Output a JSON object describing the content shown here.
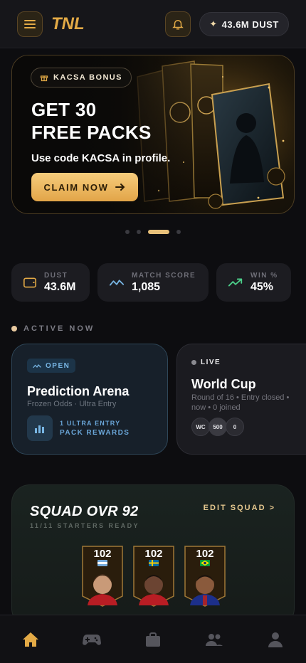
{
  "header": {
    "logo": "TNL",
    "dust_balance": "43.6M DUST"
  },
  "hero": {
    "badge": "KACSA BONUS",
    "title_line1": "GET 30",
    "title_line2": "FREE PACKS",
    "subtitle": "Use code KACSA in profile.",
    "cta": "CLAIM NOW",
    "slides_total": 4,
    "slide_active": 3
  },
  "stats": [
    {
      "label": "DUST",
      "value": "43.6M",
      "icon": "wallet-icon"
    },
    {
      "label": "MATCH SCORE",
      "value": "1,085",
      "icon": "activity-icon"
    },
    {
      "label": "WIN %",
      "value": "45%",
      "icon": "trending-up-icon"
    }
  ],
  "active_section": {
    "label": "ACTIVE NOW",
    "cards": [
      {
        "status": "OPEN",
        "title": "Prediction Arena",
        "subtitle": "Frozen Odds · Ultra Entry",
        "reward_line1": "1 ULTRA ENTRY",
        "reward_line2": "PACK REWARDS"
      },
      {
        "status": "LIVE",
        "title": "World Cup",
        "subtitle_line1": "Round of 16 • Entry closed •",
        "subtitle_line2": "now • 0 joined",
        "chips": [
          "WC",
          "500",
          "0"
        ]
      }
    ]
  },
  "squad": {
    "title": "SQUAD OVR 92",
    "subtitle": "11/11 STARTERS READY",
    "edit": "EDIT SQUAD >",
    "players": [
      {
        "ovr": "102",
        "flag": "argentina",
        "kit": "#b81d24"
      },
      {
        "ovr": "102",
        "flag": "sweden",
        "kit": "#b81d24"
      },
      {
        "ovr": "102",
        "flag": "brazil",
        "kit": "#1c2f8a"
      }
    ]
  },
  "colors": {
    "accent_gold": "#e3aa46",
    "background": "#0d0d10",
    "blue_accent": "#78b6e4",
    "green_accent": "#4ccf8a"
  },
  "nav": [
    "home",
    "games",
    "bag",
    "friends",
    "profile"
  ]
}
